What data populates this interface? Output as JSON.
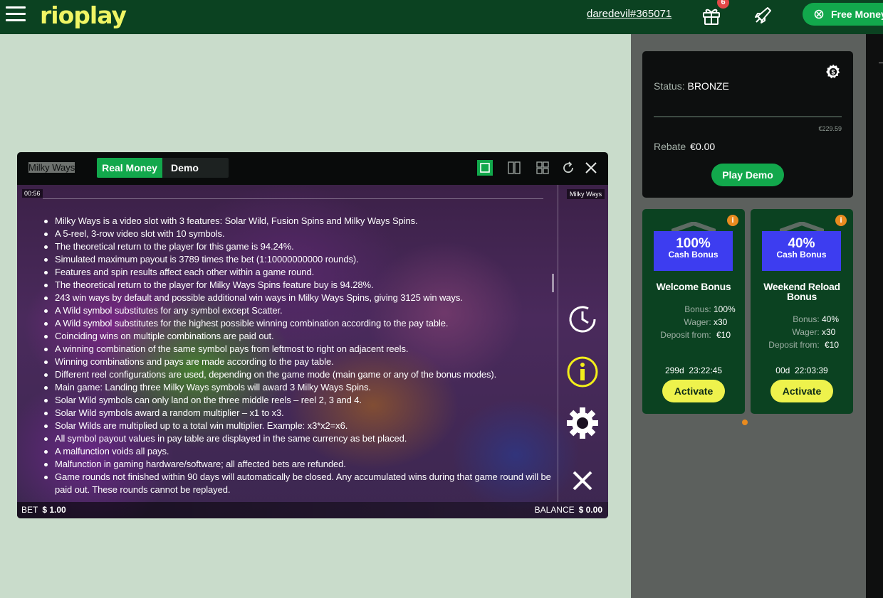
{
  "header": {
    "logo_text": "rioplay",
    "username": "daredevil#365071",
    "gift_badge_count": "6",
    "free_money_label": "Free Money"
  },
  "status_card": {
    "status_label": "Status:",
    "status_value": "BRONZE",
    "progress_amount": "€229.59",
    "rebate_label": "Rebate",
    "rebate_value": "€0.00",
    "play_demo_label": "Play Demo"
  },
  "bonuses": [
    {
      "percent": "100%",
      "type": "Cash Bonus",
      "title": "Welcome Bonus",
      "bonus_label": "Bonus:",
      "bonus_value": "100%",
      "wager_label": "Wager:",
      "wager_value": "x30",
      "deposit_label": "Deposit from:",
      "deposit_value": "€10",
      "timer": "299d  23:22:45",
      "activate_label": "Activate"
    },
    {
      "percent": "40%",
      "type": "Cash Bonus",
      "title_line1": "Weekend Reload",
      "title_line2": "Bonus",
      "bonus_label": "Bonus:",
      "bonus_value": "40%",
      "wager_label": "Wager:",
      "wager_value": "x30",
      "deposit_label": "Deposit from:",
      "deposit_value": "€10",
      "timer": "00d  22:03:39",
      "activate_label": "Activate"
    }
  ],
  "game": {
    "title": "Milky Ways",
    "tab_real": "Real Money",
    "tab_demo": "Demo",
    "time": "00:56",
    "side_title": "Milky Ways",
    "rules": [
      "Milky Ways is a video slot with 3 features: Solar Wild, Fusion Spins and Milky Ways Spins.",
      "A 5-reel, 3-row video slot with 10 symbols.",
      "The theoretical return to the player for this game is 94.24%.",
      "Simulated maximum payout is 3789 times the bet (1:10000000000 rounds).",
      "Features and spin results affect each other within a game round.",
      "The theoretical return to the player for Milky Ways Spins feature buy is 94.28%.",
      "243 win ways by default and possible additional win ways in Milky Ways Spins, giving 3125 win ways.",
      "A Wild symbol substitutes for any symbol except Scatter.",
      "A Wild symbol substitutes for the highest possible winning combination according to the pay table.",
      "Coinciding wins on multiple combinations are paid out.",
      "A winning combination of the same symbol pays from leftmost to right on adjacent reels.",
      "Winning combinations and pays are made according to the pay table.",
      "Different reel configurations are used, depending on the game mode (main game or any of the bonus modes).",
      "Main game: Landing three Milky Ways symbols will award 3 Milky Ways Spins.",
      "Solar Wild symbols can only land on the three middle reels – reel 2, 3 and 4.",
      "Solar Wild symbols award a random multiplier – x1 to x3.",
      "Solar Wilds are multiplied up to a total win multiplier. Example: x3*x2=x6.",
      "All symbol payout values in pay table are displayed in the same currency as bet placed.",
      "A malfunction voids all pays.",
      "Malfunction in gaming hardware/software; all affected bets are refunded.",
      "Game rounds not finished within 90 days will automatically be closed. Any accumulated wins during that game round will be paid out. These rounds cannot be replayed."
    ],
    "bet_label": "BET",
    "bet_value": "$ 1.00",
    "balance_label": "BALANCE",
    "balance_value": "$ 0.00"
  },
  "icons": {
    "menu": "hamburger-icon",
    "gift": "gift-icon",
    "rocket": "rocket-icon",
    "settings": "settings-gear-icon",
    "history": "history-clock-icon",
    "info": "info-icon",
    "close": "close-icon"
  },
  "colors": {
    "topbar": "#0b4221",
    "accent_green": "#12a84c",
    "logo_yellow": "#f0f564",
    "activate_yellow": "#eef24c",
    "bonus_blue": "#3d3df0",
    "badge_red": "#e24848",
    "info_orange": "#e98b1f",
    "info_icon_yellow": "#f2ee1a"
  }
}
